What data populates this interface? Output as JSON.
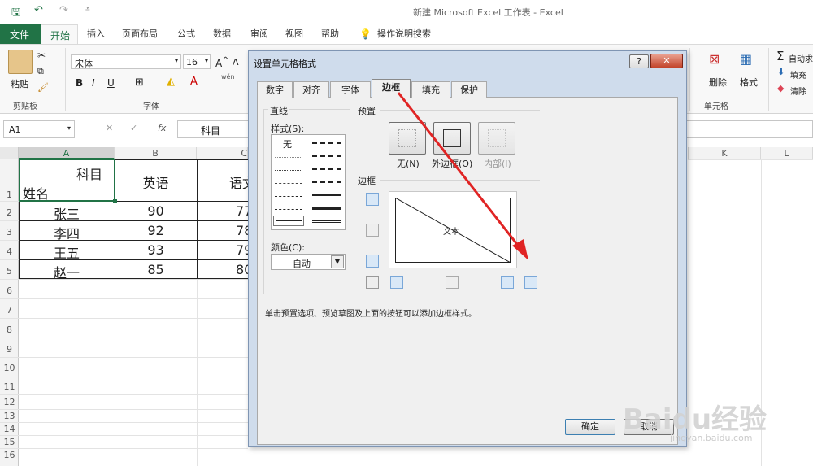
{
  "window": {
    "title": "新建 Microsoft Excel 工作表  -  Excel"
  },
  "ribbon_tabs": [
    "文件",
    "开始",
    "插入",
    "页面布局",
    "公式",
    "数据",
    "审阅",
    "视图",
    "帮助",
    "操作说明搜索"
  ],
  "ribbon": {
    "paste": "粘贴",
    "clipboard": "剪贴板",
    "font_name": "宋体",
    "font_size": "16",
    "font_group": "字体",
    "delete": "删除",
    "format": "格式",
    "cells_group": "单元格",
    "autosum": "自动求",
    "fill": "填充",
    "clear": "清除",
    "bold": "B",
    "italic": "I",
    "underline": "U",
    "wen": "wén"
  },
  "formula_bar": {
    "name_box": "A1",
    "fx": "fx",
    "content": "科目"
  },
  "sheet": {
    "columns": [
      "A",
      "B",
      "C",
      "K",
      "L"
    ],
    "rows": [
      "1",
      "2",
      "3",
      "4",
      "5",
      "6",
      "7",
      "8",
      "9",
      "10",
      "11",
      "12",
      "13",
      "14",
      "15",
      "16"
    ],
    "header": {
      "a1_top": "科目",
      "a1_bottom": "姓名",
      "b1": "英语",
      "c1": "语文"
    },
    "data": [
      [
        "张三",
        "90",
        "77"
      ],
      [
        "李四",
        "92",
        "78"
      ],
      [
        "王五",
        "93",
        "79"
      ],
      [
        "赵一",
        "85",
        "80"
      ]
    ]
  },
  "dialog": {
    "title": "设置单元格格式",
    "tabs": [
      "数字",
      "对齐",
      "字体",
      "边框",
      "填充",
      "保护"
    ],
    "line_section": "直线",
    "style_label": "样式(S):",
    "none_label": "无",
    "color_label": "颜色(C):",
    "color_value": "自动",
    "presets_section": "预置",
    "preset_labels": [
      "无(N)",
      "外边框(O)",
      "内部(I)"
    ],
    "border_section": "边框",
    "preview_text": "文本",
    "hint": "单击预置选项、预览草图及上面的按钮可以添加边框样式。",
    "ok": "确定",
    "cancel": "取消",
    "help": "?",
    "close": "✕"
  },
  "watermark": {
    "brand": "Baidu经验",
    "url": "jingyan.baidu.com"
  },
  "accent": "#217346"
}
